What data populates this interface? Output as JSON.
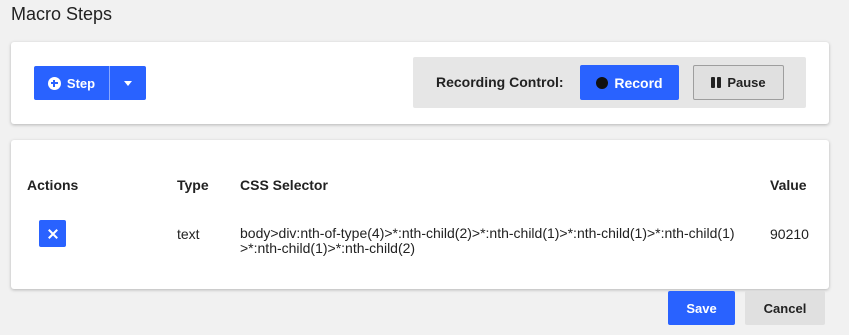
{
  "page": {
    "title": "Macro Steps"
  },
  "toolbar": {
    "step_label": "Step",
    "recording_label": "Recording Control:",
    "record_label": "Record",
    "pause_label": "Pause"
  },
  "table": {
    "headers": {
      "actions": "Actions",
      "type": "Type",
      "css_selector": "CSS Selector",
      "value": "Value"
    },
    "rows": [
      {
        "type": "text",
        "css_selector": "body>div:nth-of-type(4)>*:nth-child(2)>*:nth-child(1)>*:nth-child(1)>*:nth-child(1)>*:nth-child(1)>*:nth-child(2)",
        "value": "90210"
      }
    ]
  },
  "footer": {
    "save_label": "Save",
    "cancel_label": "Cancel"
  },
  "colors": {
    "primary": "#2962ff",
    "background": "#f1f1f1",
    "panel": "#e6e6e6"
  },
  "icons": [
    "plus-circle-icon",
    "chevron-down-icon",
    "record-dot-icon",
    "pause-icon",
    "close-icon"
  ]
}
